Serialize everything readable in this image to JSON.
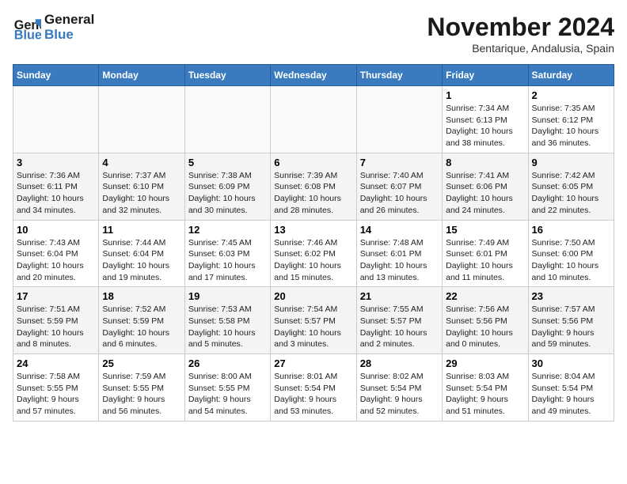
{
  "header": {
    "logo_line1": "General",
    "logo_line2": "Blue",
    "month": "November 2024",
    "location": "Bentarique, Andalusia, Spain"
  },
  "weekdays": [
    "Sunday",
    "Monday",
    "Tuesday",
    "Wednesday",
    "Thursday",
    "Friday",
    "Saturday"
  ],
  "weeks": [
    [
      {
        "day": "",
        "info": ""
      },
      {
        "day": "",
        "info": ""
      },
      {
        "day": "",
        "info": ""
      },
      {
        "day": "",
        "info": ""
      },
      {
        "day": "",
        "info": ""
      },
      {
        "day": "1",
        "info": "Sunrise: 7:34 AM\nSunset: 6:13 PM\nDaylight: 10 hours\nand 38 minutes."
      },
      {
        "day": "2",
        "info": "Sunrise: 7:35 AM\nSunset: 6:12 PM\nDaylight: 10 hours\nand 36 minutes."
      }
    ],
    [
      {
        "day": "3",
        "info": "Sunrise: 7:36 AM\nSunset: 6:11 PM\nDaylight: 10 hours\nand 34 minutes."
      },
      {
        "day": "4",
        "info": "Sunrise: 7:37 AM\nSunset: 6:10 PM\nDaylight: 10 hours\nand 32 minutes."
      },
      {
        "day": "5",
        "info": "Sunrise: 7:38 AM\nSunset: 6:09 PM\nDaylight: 10 hours\nand 30 minutes."
      },
      {
        "day": "6",
        "info": "Sunrise: 7:39 AM\nSunset: 6:08 PM\nDaylight: 10 hours\nand 28 minutes."
      },
      {
        "day": "7",
        "info": "Sunrise: 7:40 AM\nSunset: 6:07 PM\nDaylight: 10 hours\nand 26 minutes."
      },
      {
        "day": "8",
        "info": "Sunrise: 7:41 AM\nSunset: 6:06 PM\nDaylight: 10 hours\nand 24 minutes."
      },
      {
        "day": "9",
        "info": "Sunrise: 7:42 AM\nSunset: 6:05 PM\nDaylight: 10 hours\nand 22 minutes."
      }
    ],
    [
      {
        "day": "10",
        "info": "Sunrise: 7:43 AM\nSunset: 6:04 PM\nDaylight: 10 hours\nand 20 minutes."
      },
      {
        "day": "11",
        "info": "Sunrise: 7:44 AM\nSunset: 6:04 PM\nDaylight: 10 hours\nand 19 minutes."
      },
      {
        "day": "12",
        "info": "Sunrise: 7:45 AM\nSunset: 6:03 PM\nDaylight: 10 hours\nand 17 minutes."
      },
      {
        "day": "13",
        "info": "Sunrise: 7:46 AM\nSunset: 6:02 PM\nDaylight: 10 hours\nand 15 minutes."
      },
      {
        "day": "14",
        "info": "Sunrise: 7:48 AM\nSunset: 6:01 PM\nDaylight: 10 hours\nand 13 minutes."
      },
      {
        "day": "15",
        "info": "Sunrise: 7:49 AM\nSunset: 6:01 PM\nDaylight: 10 hours\nand 11 minutes."
      },
      {
        "day": "16",
        "info": "Sunrise: 7:50 AM\nSunset: 6:00 PM\nDaylight: 10 hours\nand 10 minutes."
      }
    ],
    [
      {
        "day": "17",
        "info": "Sunrise: 7:51 AM\nSunset: 5:59 PM\nDaylight: 10 hours\nand 8 minutes."
      },
      {
        "day": "18",
        "info": "Sunrise: 7:52 AM\nSunset: 5:59 PM\nDaylight: 10 hours\nand 6 minutes."
      },
      {
        "day": "19",
        "info": "Sunrise: 7:53 AM\nSunset: 5:58 PM\nDaylight: 10 hours\nand 5 minutes."
      },
      {
        "day": "20",
        "info": "Sunrise: 7:54 AM\nSunset: 5:57 PM\nDaylight: 10 hours\nand 3 minutes."
      },
      {
        "day": "21",
        "info": "Sunrise: 7:55 AM\nSunset: 5:57 PM\nDaylight: 10 hours\nand 2 minutes."
      },
      {
        "day": "22",
        "info": "Sunrise: 7:56 AM\nSunset: 5:56 PM\nDaylight: 10 hours\nand 0 minutes."
      },
      {
        "day": "23",
        "info": "Sunrise: 7:57 AM\nSunset: 5:56 PM\nDaylight: 9 hours\nand 59 minutes."
      }
    ],
    [
      {
        "day": "24",
        "info": "Sunrise: 7:58 AM\nSunset: 5:55 PM\nDaylight: 9 hours\nand 57 minutes."
      },
      {
        "day": "25",
        "info": "Sunrise: 7:59 AM\nSunset: 5:55 PM\nDaylight: 9 hours\nand 56 minutes."
      },
      {
        "day": "26",
        "info": "Sunrise: 8:00 AM\nSunset: 5:55 PM\nDaylight: 9 hours\nand 54 minutes."
      },
      {
        "day": "27",
        "info": "Sunrise: 8:01 AM\nSunset: 5:54 PM\nDaylight: 9 hours\nand 53 minutes."
      },
      {
        "day": "28",
        "info": "Sunrise: 8:02 AM\nSunset: 5:54 PM\nDaylight: 9 hours\nand 52 minutes."
      },
      {
        "day": "29",
        "info": "Sunrise: 8:03 AM\nSunset: 5:54 PM\nDaylight: 9 hours\nand 51 minutes."
      },
      {
        "day": "30",
        "info": "Sunrise: 8:04 AM\nSunset: 5:54 PM\nDaylight: 9 hours\nand 49 minutes."
      }
    ]
  ]
}
